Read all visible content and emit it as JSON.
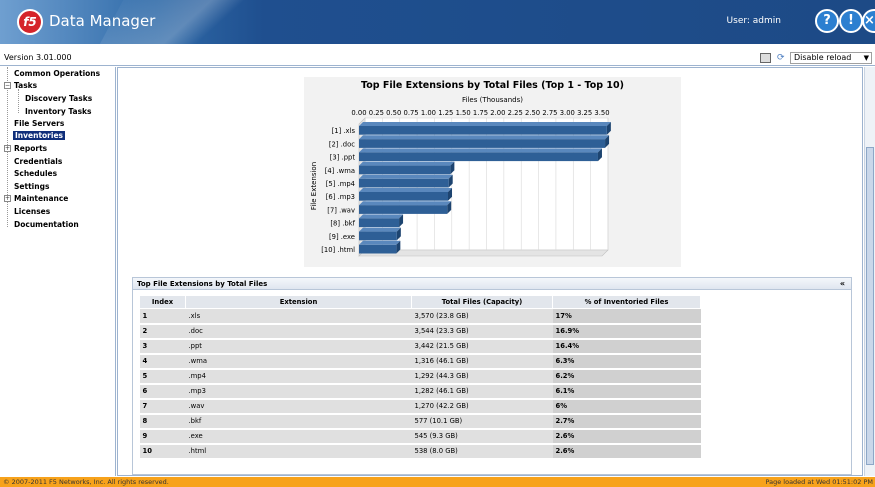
{
  "header": {
    "app_title": "Data Manager",
    "logo_text": "f5",
    "user_label": "User: admin",
    "icons": [
      "help-icon",
      "info-icon",
      "close-icon"
    ]
  },
  "toolbar": {
    "version": "Version 3.01.000",
    "reload_select": "Disable reload"
  },
  "sidebar": {
    "items": [
      {
        "label": "Common Operations"
      },
      {
        "label": "Tasks"
      },
      {
        "label": "Discovery Tasks"
      },
      {
        "label": "Inventory Tasks"
      },
      {
        "label": "File Servers"
      },
      {
        "label": "Inventories"
      },
      {
        "label": "Reports"
      },
      {
        "label": "Credentials"
      },
      {
        "label": "Schedules"
      },
      {
        "label": "Settings"
      },
      {
        "label": "Maintenance"
      },
      {
        "label": "Licenses"
      },
      {
        "label": "Documentation"
      }
    ]
  },
  "chart_data": {
    "type": "bar",
    "orientation": "horizontal",
    "title": "Top File Extensions by Total Files (Top 1 - Top 10)",
    "xlabel": "Files (Thousands)",
    "ylabel": "File Extension",
    "xlim": [
      0,
      3.5
    ],
    "x_ticks": [
      "0.00",
      "0.25",
      "0.50",
      "0.75",
      "1.00",
      "1.25",
      "1.50",
      "1.75",
      "2.00",
      "2.25",
      "2.50",
      "2.75",
      "3.00",
      "3.25",
      "3.50"
    ],
    "categories": [
      "[1] .xls",
      "[2] .doc",
      "[3] .ppt",
      "[4] .wma",
      "[5] .mp4",
      "[6] .mp3",
      "[7] .wav",
      "[8] .bkf",
      "[9] .exe",
      "[10] .html"
    ],
    "values": [
      3.57,
      3.544,
      3.442,
      1.316,
      1.292,
      1.282,
      1.27,
      0.577,
      0.545,
      0.538
    ],
    "bar_color": "#2e5f96",
    "grid": true
  },
  "table": {
    "panel_title": "Top File Extensions by Total Files",
    "collapse_glyph": "«",
    "headers": [
      "Index",
      "Extension",
      "Total Files (Capacity)",
      "% of Inventoried Files"
    ],
    "rows": [
      [
        "1",
        ".xls",
        "3,570 (23.8 GB)",
        "17%"
      ],
      [
        "2",
        ".doc",
        "3,544 (23.3 GB)",
        "16.9%"
      ],
      [
        "3",
        ".ppt",
        "3,442 (21.5 GB)",
        "16.4%"
      ],
      [
        "4",
        ".wma",
        "1,316 (46.1 GB)",
        "6.3%"
      ],
      [
        "5",
        ".mp4",
        "1,292 (44.3 GB)",
        "6.2%"
      ],
      [
        "6",
        ".mp3",
        "1,282 (46.1 GB)",
        "6.1%"
      ],
      [
        "7",
        ".wav",
        "1,270 (42.2 GB)",
        "6%"
      ],
      [
        "8",
        ".bkf",
        "577 (10.1 GB)",
        "2.7%"
      ],
      [
        "9",
        ".exe",
        "545 (9.3 GB)",
        "2.6%"
      ],
      [
        "10",
        ".html",
        "538 (8.0 GB)",
        "2.6%"
      ]
    ]
  },
  "footer": {
    "copyright": "© 2007-2011 F5 Networks, Inc. All rights reserved.",
    "status": "Page loaded at Wed 01:51:02 PM"
  },
  "colors": {
    "header_bg": "#1d4a86",
    "footer_bg": "#f7a21b",
    "active_nav": "#0f2e7a"
  }
}
